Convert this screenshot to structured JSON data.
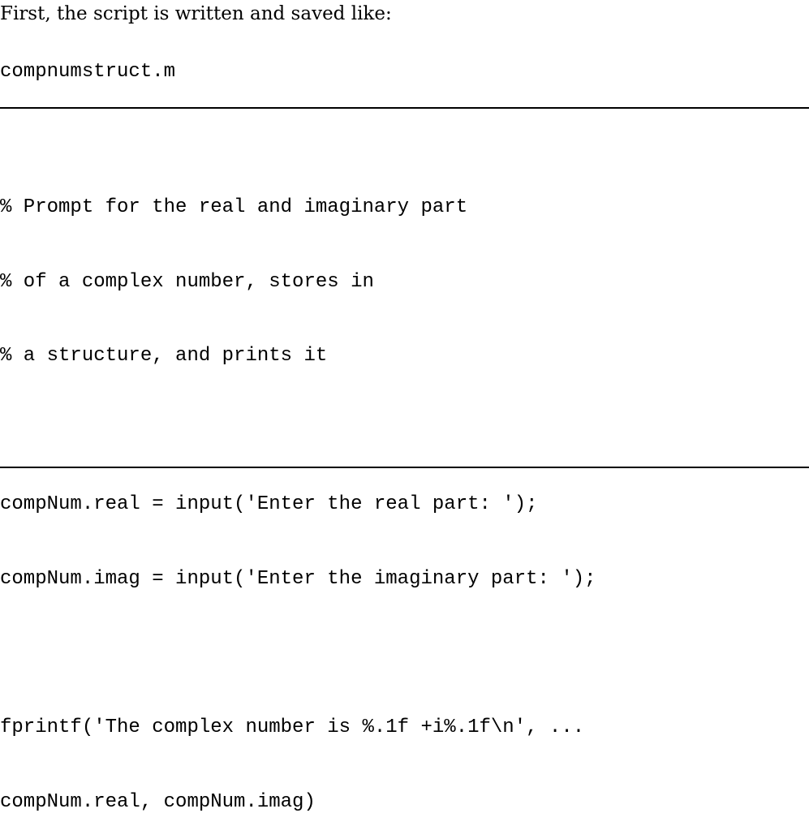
{
  "intro_text": "First, the script is written and saved like:",
  "filename": "compnumstruct.m",
  "code_lines": [
    "% Prompt for the real and imaginary part",
    "% of a complex number, stores in",
    "% a structure, and prints it",
    "",
    "compNum.real = input('Enter the real part: ');",
    "compNum.imag = input('Enter the imaginary part: ');",
    "",
    "fprintf('The complex number is %.1f +i%.1f\\n', ...",
    "compNum.real, compNum.imag)"
  ]
}
